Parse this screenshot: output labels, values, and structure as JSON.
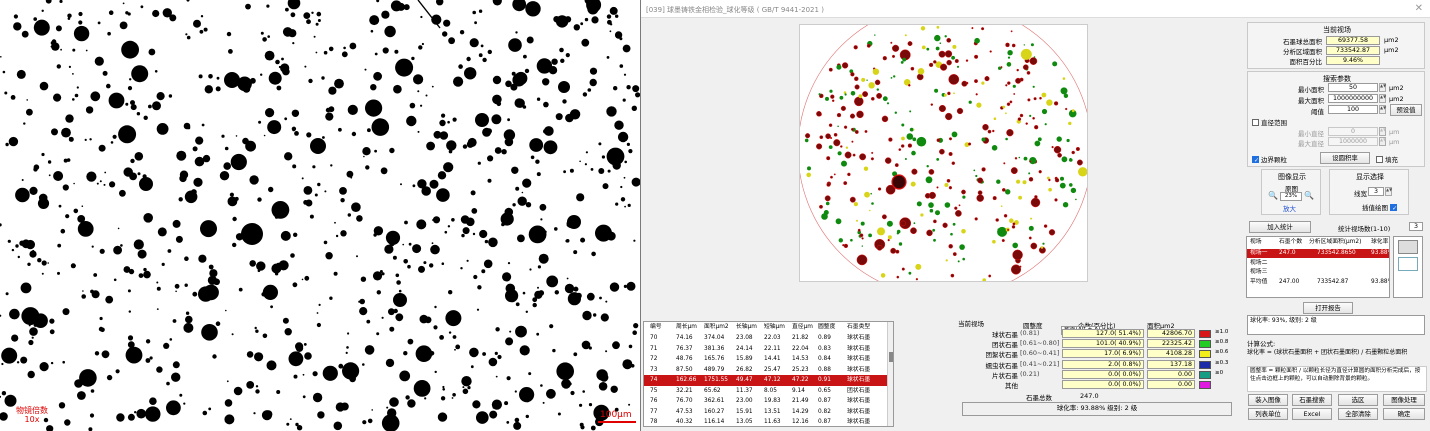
{
  "micro": {
    "magnification": "物镜倍数\n10x",
    "scale": "100μm"
  },
  "window": {
    "title": "[039] 球墨铸铁金相检验_球化等级 ( GB/T 9441-2021 )",
    "close_glyph": "✕"
  },
  "current_field": {
    "title": "当前视场",
    "rows": [
      {
        "label": "石墨球总面积",
        "value": "69377.58",
        "unit": "μm2"
      },
      {
        "label": "分析区域面积",
        "value": "733542.87",
        "unit": "μm2"
      },
      {
        "label": "面积百分比",
        "value": "9.46%",
        "unit": ""
      }
    ]
  },
  "search": {
    "title": "搜索参数",
    "min_area_label": "最小面积",
    "min_area": "50",
    "min_area_unit": "μm2",
    "max_area_label": "最大面积",
    "max_area": "1000000000",
    "max_area_unit": "μm2",
    "threshold_label": "阈值",
    "threshold": "100",
    "preset_button": "预设值",
    "diameter_range_label": "直径范围",
    "min_diam_label": "最小直径",
    "min_diam": "0",
    "min_diam_unit": "μm",
    "max_diam_label": "最大直径",
    "max_diam": "1000000",
    "max_diam_unit": "μm",
    "edge_particles_label": "边界颗粒",
    "roundness_button": "设圆积率",
    "fill_label": "填充"
  },
  "display": {
    "image_title": "图像显示",
    "original_label": "原图",
    "zoom": "23%",
    "zoom_in_label": "放大",
    "options_title": "显示选择",
    "line_width_label": "线宽",
    "line_width": "3",
    "interp_label": "插值绘图"
  },
  "stats_fields": {
    "add_button": "加入统计",
    "count_label": "统计视场数(1-10)",
    "count": "3"
  },
  "view_table": {
    "headers": [
      "视场",
      "石墨个数",
      "分析区域面积(μm2)",
      "球化率"
    ],
    "rows": [
      {
        "c": [
          "视场一",
          "247.0",
          "733542.8650",
          "93.88%"
        ],
        "sel": true
      },
      {
        "c": [
          "视场二",
          "",
          "",
          ""
        ],
        "sel": false
      },
      {
        "c": [
          "视场三",
          "",
          "",
          ""
        ],
        "sel": false
      },
      {
        "c": [
          "平均值",
          "247.00",
          "733542.87",
          "93.88%"
        ],
        "sel": false
      }
    ]
  },
  "report": {
    "print_button": "打开报告",
    "result": "球化率: 93%, 级别: 2 级",
    "formula_title": "计算公式:",
    "formula": "球化率 = (球状石墨面积 + 团状石墨面积) / 石墨颗粒总面积",
    "note": "圆整率 = 颗粒面积 / 以颗粒长径为直径计算圆的面积分析完成后，按住点击边框上的颗粒，可以自动删除背景的颗粒。"
  },
  "particle_table": {
    "headers": [
      "编号",
      "周长μm",
      "面积μm2",
      "长轴μm",
      "短轴μm",
      "直径μm",
      "圆整度",
      "石墨类型"
    ],
    "rows": [
      {
        "c": [
          "70",
          "74.16",
          "374.04",
          "23.08",
          "22.03",
          "21.82",
          "0.89",
          "球状石墨"
        ],
        "sel": false
      },
      {
        "c": [
          "71",
          "76.37",
          "381.36",
          "24.14",
          "22.11",
          "22.04",
          "0.83",
          "球状石墨"
        ],
        "sel": false
      },
      {
        "c": [
          "72",
          "48.76",
          "165.76",
          "15.89",
          "14.41",
          "14.53",
          "0.84",
          "球状石墨"
        ],
        "sel": false
      },
      {
        "c": [
          "73",
          "87.50",
          "489.79",
          "26.82",
          "25.47",
          "25.23",
          "0.88",
          "球状石墨"
        ],
        "sel": false
      },
      {
        "c": [
          "74",
          "162.66",
          "1751.55",
          "49.47",
          "47.12",
          "47.22",
          "0.91",
          "球状石墨"
        ],
        "sel": true
      },
      {
        "c": [
          "75",
          "32.21",
          "65.62",
          "11.37",
          "8.05",
          "9.14",
          "0.65",
          "团状石墨"
        ],
        "sel": false
      },
      {
        "c": [
          "76",
          "76.70",
          "362.61",
          "23.00",
          "19.83",
          "21.49",
          "0.87",
          "球状石墨"
        ],
        "sel": false
      },
      {
        "c": [
          "77",
          "47.53",
          "160.27",
          "15.91",
          "13.51",
          "14.29",
          "0.82",
          "球状石墨"
        ],
        "sel": false
      },
      {
        "c": [
          "78",
          "40.32",
          "116.14",
          "13.05",
          "11.63",
          "12.16",
          "0.87",
          "球状石墨"
        ],
        "sel": false
      }
    ]
  },
  "stats": {
    "field_label": "当前视场",
    "roundness_header": "圆整度",
    "count_header": "个数(百分比)",
    "area_header": "面积μm2",
    "tooltip": "截面(Alt + A)",
    "rows": [
      {
        "label": "球状石墨",
        "range": "(0.81)",
        "count": "127.0( 51.4%)",
        "area": "42806.70",
        "color": "#d81818",
        "tag": "≥1.0"
      },
      {
        "label": "团状石墨",
        "range": "[0.61~0.80]",
        "count": "101.0( 40.9%)",
        "area": "22325.42",
        "color": "#22cc22",
        "tag": "≥0.8"
      },
      {
        "label": "团絮状石墨",
        "range": "[0.60~0.41]",
        "count": "17.0( 6.9%)",
        "area": "4108.28",
        "color": "#f2ee1a",
        "tag": "≥0.6"
      },
      {
        "label": "蠕虫状石墨",
        "range": "[0.41~0.21]",
        "count": "2.0( 0.8%)",
        "area": "137.18",
        "color": "#1c2ca8",
        "tag": "≥0.3"
      },
      {
        "label": "片状石墨",
        "range": "(0.21)",
        "count": "0.0( 0.0%)",
        "area": "0.00",
        "color": "#169e84",
        "tag": "≥0"
      },
      {
        "label": "其他",
        "range": "",
        "count": "0.0( 0.0%)",
        "area": "0.00",
        "color": "#e018e0",
        "tag": ""
      }
    ],
    "total_label": "石墨总数",
    "total": "247.0",
    "summary": "球化率: 93.88%  级别: 2 级"
  },
  "buttons": [
    "装入图像",
    "石墨搜索",
    "选区",
    "图像处理",
    "列表单位",
    "Excel",
    "全部清除",
    "确定"
  ]
}
